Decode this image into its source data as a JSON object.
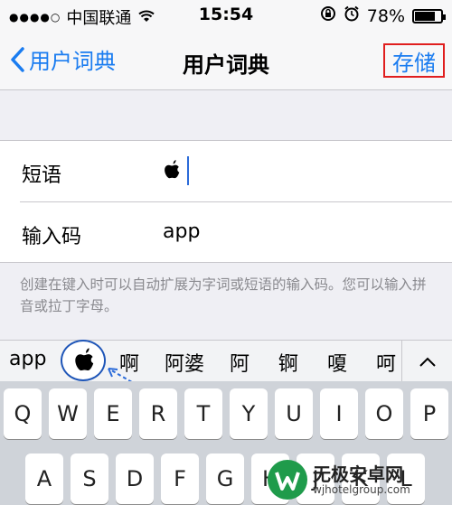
{
  "status": {
    "signal_dots": "●●●●○",
    "carrier": "中国联通",
    "time": "15:54",
    "battery_percent": "78%",
    "battery_level": 0.78
  },
  "nav": {
    "back_label": "用户词典",
    "title": "用户词典",
    "save_label": "存储"
  },
  "form": {
    "phrase_label": "短语",
    "phrase_value": "apple-logo",
    "code_label": "输入码",
    "code_value": "app"
  },
  "note": "创建在键入时可以自动扩展为字词或短语的输入码。您可以输入拼音或拉丁字母。",
  "suggestions": [
    "app",
    "apple-logo",
    "啊",
    "阿婆",
    "阿",
    "锕",
    "嗄",
    "呵"
  ],
  "keyboard": {
    "row1": [
      "Q",
      "W",
      "E",
      "R",
      "T",
      "Y",
      "U",
      "I",
      "O",
      "P"
    ],
    "row2": [
      "A",
      "S",
      "D",
      "F",
      "G",
      "H",
      "J",
      "K",
      "L"
    ]
  },
  "watermark": {
    "name": "无极安卓网",
    "url": "wjhotelgroup.com"
  },
  "colors": {
    "accent": "#1a7cf0",
    "highlight_border": "#e01e1e",
    "selection_ring": "#1f56b8"
  }
}
